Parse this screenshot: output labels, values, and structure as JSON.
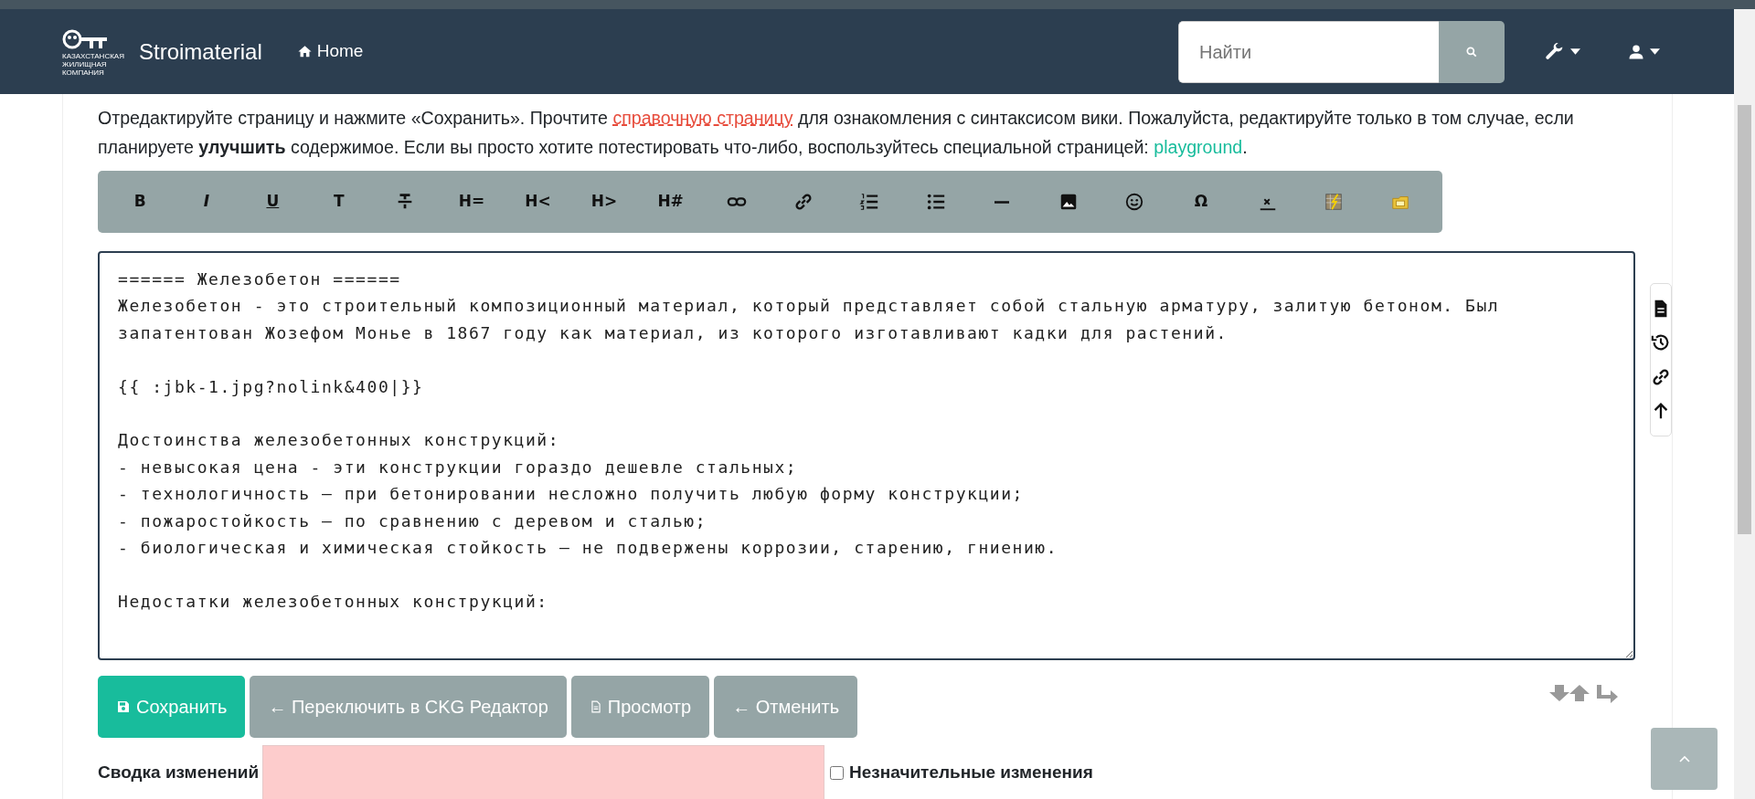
{
  "navbar": {
    "brand": "Stroimaterial",
    "logo_caption": [
      "КАЗАХСТАНСКАЯ",
      "ЖИЛИЩНАЯ",
      "КОМПАНИЯ"
    ],
    "home": "Home",
    "search": {
      "placeholder": "Найти"
    }
  },
  "intro": [
    {
      "kind": "text",
      "text": "Отредактируйте страницу и нажмите «Сохранить». Прочтите "
    },
    {
      "kind": "missing_link",
      "text": "справочную страницу"
    },
    {
      "kind": "text",
      "text": " для ознакомления с синтаксисом вики. Пожалуйста, редактируйте только в том случае, если планируете **улучшить** содержимое. Если вы просто хотите потестировать что-либо, воспользуйтесь специальной страницей: "
    },
    {
      "kind": "link",
      "text": "playground"
    },
    {
      "kind": "text",
      "text": "."
    }
  ],
  "toolbar": [
    {
      "kind": "text",
      "label": "B"
    },
    {
      "kind": "text",
      "label": "I"
    },
    {
      "kind": "text",
      "label": "U"
    },
    {
      "kind": "text",
      "label": "T"
    },
    {
      "kind": "icon"
    },
    {
      "kind": "text",
      "label": "H="
    },
    {
      "kind": "text",
      "label": "H<"
    },
    {
      "kind": "text",
      "label": "H>"
    },
    {
      "kind": "text",
      "label": "H#"
    },
    {
      "kind": "icon"
    },
    {
      "kind": "icon"
    },
    {
      "kind": "icon"
    },
    {
      "kind": "icon"
    },
    {
      "kind": "icon"
    },
    {
      "kind": "icon"
    },
    {
      "kind": "icon"
    },
    {
      "kind": "text",
      "label": "Ω"
    },
    {
      "kind": "icon"
    },
    {
      "kind": "icon"
    },
    {
      "kind": "icon"
    }
  ],
  "editor_paragraphs": [
    [
      "====== Железобетон ======",
      "Железобетон - это строительный композиционный материал, который представляет собой стальную арматуру, залитую бетоном. Был",
      "запатентован Жозефом Монье в 1867 году как материал, из которого изготавливают кадки для растений."
    ],
    [
      "{{ :jbk-1.jpg?nolink&400|}}"
    ],
    [
      "Достоинства железобетонных конструкций:",
      "- невысокая цена - эти конструкции гораздо дешевле стальных;",
      "- технологичность – при бетонировании несложно получить любую форму конструкции;",
      "- пожаростойкость – по сравнению с деревом и сталью;",
      "- биологическая и химическая стойкость – не подвержены коррозии, старению, гниению."
    ],
    [
      "Недостатки железобетонных конструкций:"
    ]
  ],
  "buttons": [
    {
      "kind": "primary",
      "label": "Сохранить"
    },
    {
      "kind": "secondary",
      "label": "← Переключить в CKG Редактор"
    },
    {
      "kind": "secondary",
      "label": "Просмотр"
    },
    {
      "kind": "secondary",
      "label": "← Отменить"
    }
  ],
  "summary": {
    "label": "Сводка изменений",
    "invalid": true
  },
  "minor": {
    "label": "Незначительные изменения",
    "checked": false
  }
}
